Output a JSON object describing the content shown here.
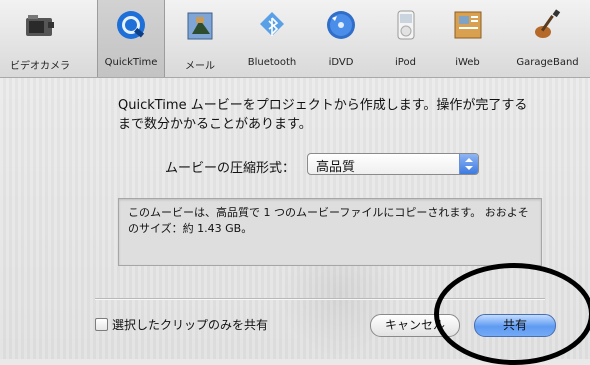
{
  "toolbar": {
    "items": [
      {
        "label": "ビデオカメラ",
        "icon": "camcorder-icon"
      },
      {
        "label": "QuickTime",
        "icon": "quicktime-icon"
      },
      {
        "label": "メール",
        "icon": "mail-icon"
      },
      {
        "label": "Bluetooth",
        "icon": "bluetooth-icon"
      },
      {
        "label": "iDVD",
        "icon": "idvd-icon"
      },
      {
        "label": "iPod",
        "icon": "ipod-icon"
      },
      {
        "label": "iWeb",
        "icon": "iweb-icon"
      },
      {
        "label": "GarageBand",
        "icon": "garageband-icon"
      }
    ],
    "selected": "QuickTime"
  },
  "main": {
    "description": "QuickTime ムービーをプロジェクトから作成します。操作が完了するまで数分かかることがあります。",
    "format_label": "ムービーの圧縮形式：",
    "format_value": "高品質",
    "info_text": "このムービーは、高品質で 1 つのムービーファイルにコピーされます。 おおよそのサイズ：約 1.43 GB。",
    "checkbox_label": "選択したクリップのみを共有",
    "checkbox_checked": false,
    "cancel_label": "キャンセル",
    "share_label": "共有"
  },
  "colors": {
    "accent": "#3d7ae0",
    "annotation": "#000000"
  }
}
